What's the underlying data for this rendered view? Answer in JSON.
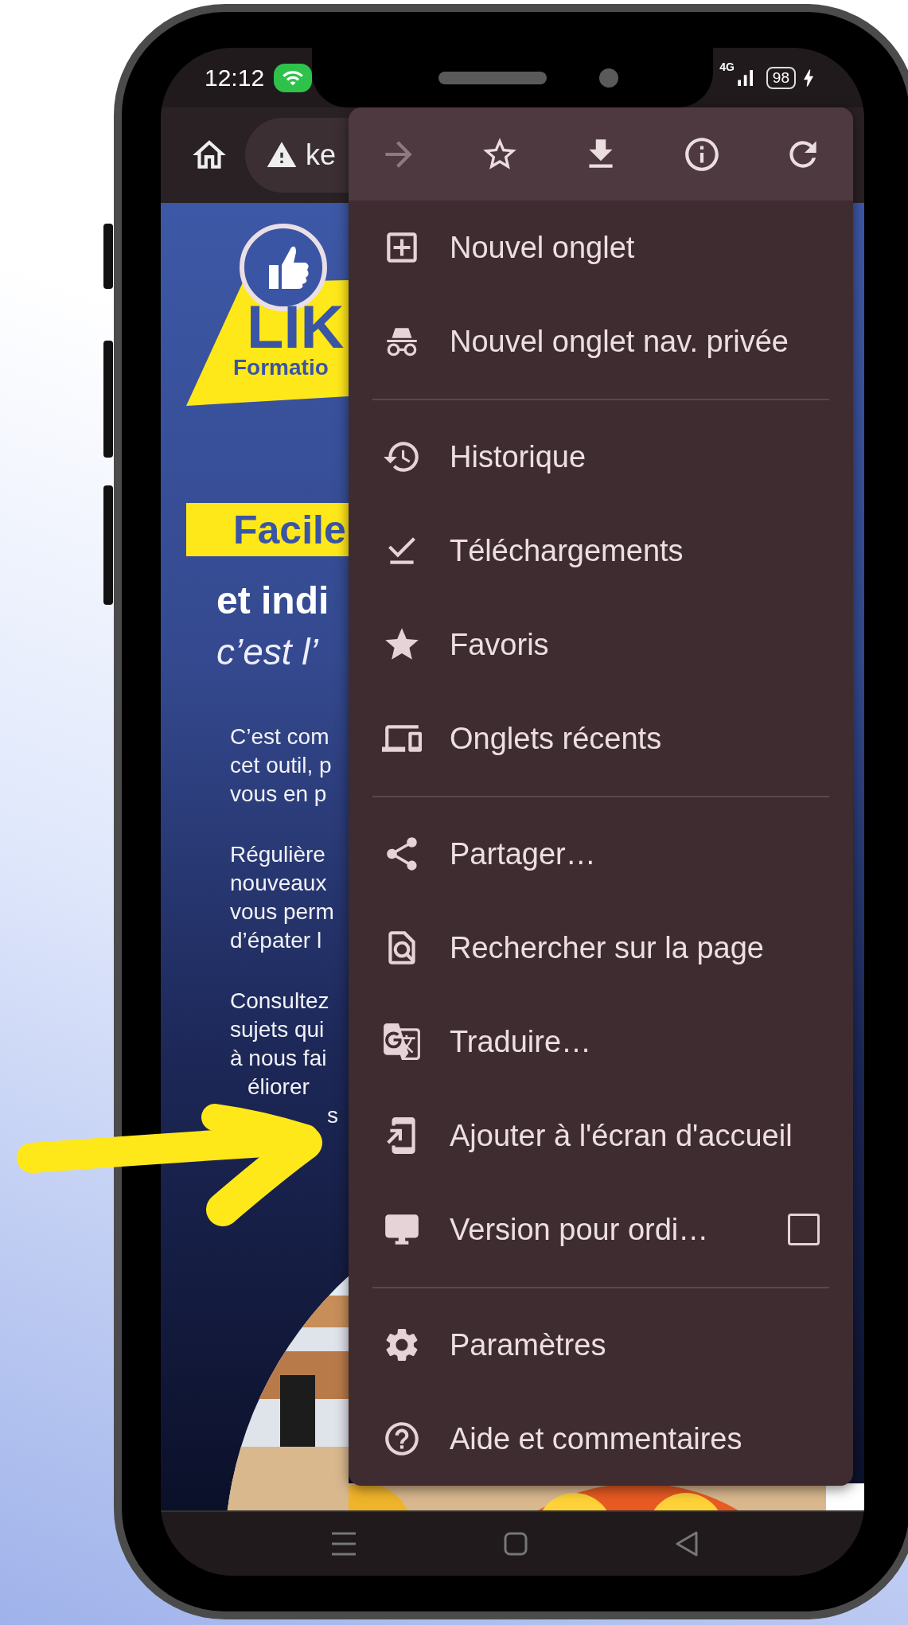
{
  "status_bar": {
    "time": "12:12",
    "network": "4G",
    "battery": "98"
  },
  "toolbar": {
    "url": "ke"
  },
  "page": {
    "logo": [
      "LIK",
      "Formatio"
    ],
    "headline": "Facile",
    "subheadline": "et indi",
    "tagline": "c’est l’",
    "paragraphs": [
      [
        "C’est com",
        "cet outil, p",
        "vous en p"
      ],
      [
        "Régulière",
        "nouveaux",
        "vous perm",
        "d’épater l"
      ],
      [
        "Consultez",
        "sujets qui",
        "à nous fai",
        "éliorer",
        "s"
      ]
    ]
  },
  "menu": {
    "actions": [
      {
        "kind": "forward",
        "disabled": true
      },
      {
        "kind": "bookmark",
        "disabled": false
      },
      {
        "kind": "download",
        "disabled": false
      },
      {
        "kind": "info",
        "disabled": false
      },
      {
        "kind": "reload",
        "disabled": false
      }
    ],
    "sections": [
      [
        {
          "kind": "new-tab",
          "label": "Nouvel onglet"
        },
        {
          "kind": "incognito",
          "label": "Nouvel onglet nav. privée"
        }
      ],
      [
        {
          "kind": "history",
          "label": "Historique"
        },
        {
          "kind": "downloads",
          "label": "Téléchargements"
        },
        {
          "kind": "bookmarks",
          "label": "Favoris"
        },
        {
          "kind": "recent-tabs",
          "label": "Onglets récents"
        }
      ],
      [
        {
          "kind": "share",
          "label": "Partager…"
        },
        {
          "kind": "find",
          "label": "Rechercher sur la page"
        },
        {
          "kind": "translate",
          "label": "Traduire…"
        },
        {
          "kind": "add-home",
          "label": "Ajouter à l'écran d'accueil"
        },
        {
          "kind": "desktop",
          "label": "Version pour ordi…",
          "checked": false
        }
      ],
      [
        {
          "kind": "settings",
          "label": "Paramètres"
        },
        {
          "kind": "help",
          "label": "Aide et commentaires"
        }
      ]
    ]
  }
}
